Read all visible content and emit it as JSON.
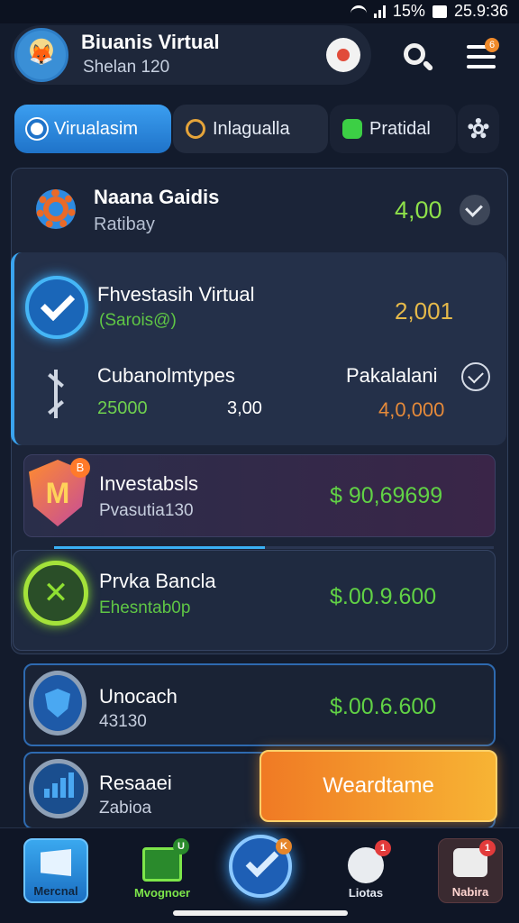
{
  "status_bar": {
    "battery": "15%",
    "time": "25.9:36"
  },
  "header": {
    "title": "Biuanis Virtual",
    "subtitle": "Shelan 120",
    "menu_badge": "6"
  },
  "tabs": [
    {
      "label": "Virualasim",
      "active": true
    },
    {
      "label": "Inlagualla"
    },
    {
      "label": "Pratidal"
    }
  ],
  "rows": {
    "top": {
      "title": "Naana Gaidis",
      "subtitle": "Ratibay",
      "value": "4,00"
    },
    "investasi": {
      "title": "Fhvestasih Virtual",
      "subtitle": "(Sarois@)",
      "value": "2,001"
    },
    "detail": {
      "title": "Cubanolmtypes",
      "right_label": "Pakalalani",
      "value_1": "25000",
      "value_2": "3,00",
      "value_3": "4,0,000"
    },
    "investabsls": {
      "title": "Investabsls",
      "subtitle": "Pvasutia130",
      "value": "$ 90,69699",
      "badge": "B"
    },
    "progress": {
      "fraction": 0.48
    },
    "prvka": {
      "title": "Prvka Bancla",
      "subtitle": "Ehesntab0p",
      "value": "$.00.9.600"
    },
    "unocach": {
      "title": "Unocach",
      "subtitle": "43130",
      "value": "$.00.6.600"
    },
    "resaaei": {
      "title": "Resaaei",
      "subtitle": "Zabioa"
    }
  },
  "cta": {
    "label": "Weardtame"
  },
  "bottom_nav": [
    {
      "label": "Mercnal",
      "icon": "window-icon"
    },
    {
      "label": "Mvognoer",
      "icon": "ledger-icon",
      "badge": "U"
    },
    {
      "label": "",
      "icon": "check-icon",
      "badge": "K"
    },
    {
      "label": "Liotas",
      "icon": "record-icon",
      "badge": "1"
    },
    {
      "label": "Nabira",
      "icon": "camera-icon",
      "badge": "1"
    }
  ],
  "colors": {
    "accent_blue": "#3b9ef0",
    "positive_green": "#61d245",
    "warning_orange": "#f07a24",
    "background": "#131b2c"
  }
}
